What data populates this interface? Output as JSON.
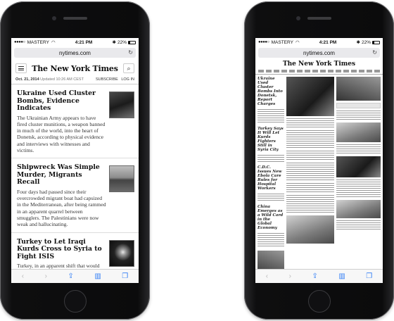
{
  "phones": {
    "left": {
      "status": {
        "carrier": "MASTERY",
        "time": "4:21 PM",
        "battery": "22%"
      },
      "url": "nytimes.com",
      "masthead": "The New York Times",
      "dateline": {
        "date": "Oct. 21, 2014",
        "updated": "Updated 10:26 AM CEST",
        "subscribe": "SUBSCRIBE",
        "login": "LOG IN"
      },
      "stories": [
        {
          "title": "Ukraine Used Cluster Bombs, Evidence Indicates",
          "body": "The Ukrainian Army appears to have fired cluster munitions, a weapon banned in much of the world, into the heart of Donetsk, according to physical evidence and interviews with witnesses and victims."
        },
        {
          "title": "Shipwreck Was Simple Murder, Migrants Recall",
          "body": "Four days had passed since their overcrowded migrant boat had capsized in the Mediterranean, after being rammed in an apparent quarrel between smugglers. The Palestinians were now weak and hallucinating."
        },
        {
          "title": "Turkey to Let Iraqi Kurds Cross to Syria to Fight ISIS",
          "body": "Turkey, in an apparent shift that would facilitate the movement of Iraqi Kurdish forces to the embattled Syrian city of Kobani to join the battle against militants."
        }
      ]
    },
    "right": {
      "status": {
        "carrier": "MASTERY",
        "time": "4:21 PM",
        "battery": "22%"
      },
      "url": "nytimes.com",
      "masthead": "The New York Times",
      "headlines": [
        "Ukraine Used Cluster Bombs Into Donetsk, Report Charges",
        "Turkey Says It Will Let Kurds Fighters Still in Syria City",
        "C.D.C. Issues New Ebola Care Rules for Hospital Workers",
        "China Emerges as a Wild Card in the Global Economy"
      ]
    }
  },
  "icons": {
    "reload": "↻",
    "back": "‹",
    "forward": "›",
    "share": "⇪",
    "bookmarks": "▥",
    "tabs": "❐",
    "search": "⌕",
    "wifi": "◠",
    "bluetooth": "✱"
  },
  "colors": {
    "toolbar_accent": "#2f7cf6",
    "phone_body": "#0e0e0f"
  }
}
